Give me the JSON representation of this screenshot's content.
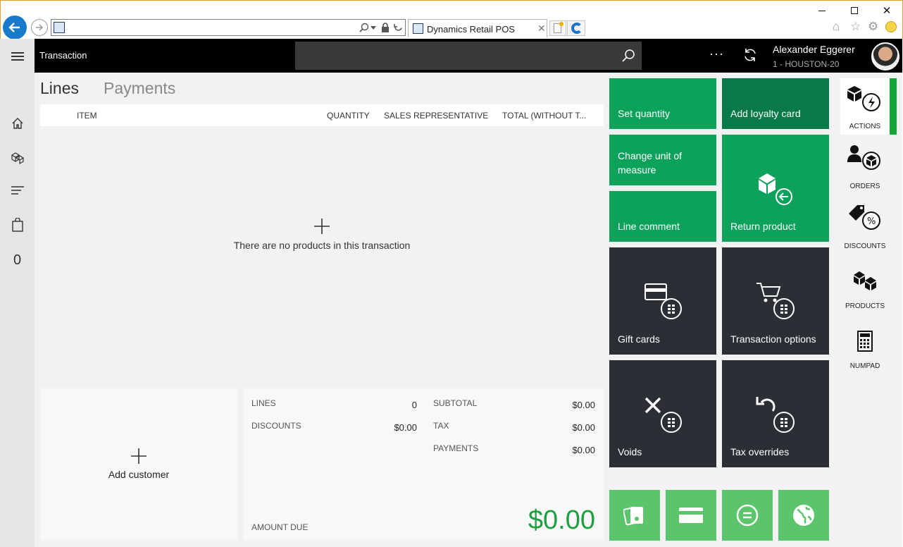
{
  "browser": {
    "tab_title": "Dynamics Retail POS",
    "address": ""
  },
  "header": {
    "title": "Transaction",
    "search_placeholder": "",
    "user_name": "Alexander Eggerer",
    "user_store": "1 - HOUSTON-20",
    "more_label": "···"
  },
  "left_nav": {
    "items": [
      "home-icon",
      "products-icon",
      "list-icon",
      "bag-icon"
    ],
    "cart_count": "0"
  },
  "pivots": {
    "lines": "Lines",
    "payments": "Payments"
  },
  "table": {
    "columns": [
      "ITEM",
      "QUANTITY",
      "SALES REPRESENTATIVE",
      "TOTAL (WITHOUT T..."
    ],
    "empty_message": "There are no products in this transaction"
  },
  "customer": {
    "add_label": "Add customer"
  },
  "totals": {
    "lines_label": "LINES",
    "lines_value": "0",
    "discounts_label": "DISCOUNTS",
    "discounts_value": "$0.00",
    "subtotal_label": "SUBTOTAL",
    "subtotal_value": "$0.00",
    "tax_label": "TAX",
    "tax_value": "$0.00",
    "payments_label": "PAYMENTS",
    "payments_value": "$0.00",
    "amount_due_label": "AMOUNT DUE",
    "amount_due_value": "$0.00"
  },
  "tiles": {
    "set_quantity": "Set quantity",
    "add_loyalty_card": "Add loyalty card",
    "change_unit": "Change unit of measure",
    "return_product": "Return product",
    "line_comment": "Line comment",
    "gift_cards": "Gift cards",
    "transaction_options": "Transaction options",
    "voids": "Voids",
    "tax_overrides": "Tax overrides"
  },
  "right_rail": {
    "actions": "ACTIONS",
    "orders": "ORDERS",
    "discounts": "DISCOUNTS",
    "products": "PRODUCTS",
    "numpad": "NUMPAD"
  },
  "colors": {
    "tile_green": "#0ca25c",
    "tile_dark_green": "#077a48",
    "tile_dark": "#2b2e35",
    "tile_light_green": "#5cc56b",
    "amount_due": "#1e9e3e",
    "active_indicator": "#13a538"
  }
}
